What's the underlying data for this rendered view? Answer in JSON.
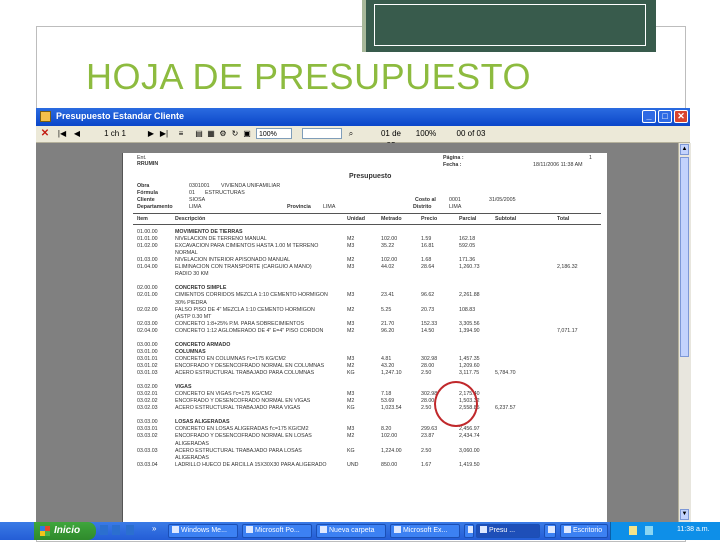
{
  "slide": {
    "title": "HOJA DE PRESUPUESTO"
  },
  "window": {
    "title": "Presupuesto Estandar Cliente",
    "toolbar": {
      "close_glyph": "✕",
      "first_glyph": "|◀",
      "prev_glyph": "◀",
      "page_indicator": "1 ch 1",
      "next_glyph": "▶",
      "last_glyph": "▶|",
      "zoom_value": "100%",
      "find_value": "",
      "status_a": "01 de 03",
      "status_b": "100%",
      "status_c": "00 of 03"
    }
  },
  "report": {
    "company_code": "Ent.",
    "company": "RRUMIN",
    "page_label": "Página :",
    "page_value": "1",
    "date_label": "Fecha :",
    "date_value": "18/11/2006  11:38  AM",
    "heading": "Presupuesto",
    "obra_label": "Obra",
    "obra_code": "0301001",
    "obra_value": "VIVIENDA UNIFAMILIAR",
    "formula_label": "Fórmula",
    "formula_code": "01",
    "formula_value": "ESTRUCTURAS",
    "cliente_label": "Cliente",
    "cliente_value": "SIOSA",
    "costo_label": "Costo al",
    "costo_code": "0001",
    "costo_value": "31/05/2005",
    "departamento_label": "Departamento",
    "departamento_value": "LIMA",
    "provincia_label": "Provincia",
    "provincia_value": "LIMA",
    "distrito_label": "Distrito",
    "distrito_value": "LIMA",
    "columns": [
      "Item",
      "Descripción",
      "Unidad",
      "Metrado",
      "Precio",
      "Parcial",
      "Subtotal",
      "Total"
    ],
    "rows": [
      {
        "item": "01.00.00",
        "desc": "MOVIMIENTO DE TIERRAS",
        "unit": "",
        "metrado": "",
        "precio": "",
        "parcial": "",
        "subtotal": "",
        "total": ""
      },
      {
        "item": "01.01.00",
        "desc": "NIVELACION DE TERRENO MANUAL",
        "unit": "M2",
        "metrado": "102.00",
        "precio": "1.59",
        "parcial": "162.18",
        "subtotal": "",
        "total": ""
      },
      {
        "item": "01.02.00",
        "desc": "EXCAVACION PARA CIMIENTOS HASTA 1.00 M TERRENO",
        "unit": "M3",
        "metrado": "35.22",
        "precio": "16.81",
        "parcial": "592.05",
        "subtotal": "",
        "total": ""
      },
      {
        "item": "",
        "desc": "NORMAL",
        "unit": "",
        "metrado": "",
        "precio": "",
        "parcial": "",
        "subtotal": "",
        "total": ""
      },
      {
        "item": "01.03.00",
        "desc": "NIVELACION INTERIOR APISONADO MANUAL",
        "unit": "M2",
        "metrado": "102.00",
        "precio": "1.68",
        "parcial": "171.36",
        "subtotal": "",
        "total": ""
      },
      {
        "item": "01.04.00",
        "desc": "ELIMINACION CON TRANSPORTE (CARGUIO A MANO)",
        "unit": "M3",
        "metrado": "44.02",
        "precio": "28.64",
        "parcial": "1,260.73",
        "subtotal": "",
        "total": "2,186.32"
      },
      {
        "item": "",
        "desc": "RADIO 30 KM",
        "unit": "",
        "metrado": "",
        "precio": "",
        "parcial": "",
        "subtotal": "",
        "total": ""
      },
      {
        "item": "",
        "desc": "",
        "unit": "",
        "metrado": "",
        "precio": "",
        "parcial": "",
        "subtotal": "",
        "total": ""
      },
      {
        "item": "02.00.00",
        "desc": "CONCRETO SIMPLE",
        "unit": "",
        "metrado": "",
        "precio": "",
        "parcial": "",
        "subtotal": "",
        "total": ""
      },
      {
        "item": "02.01.00",
        "desc": "CIMIENTOS CORRIDOS MEZCLA 1:10 CEMENTO HORMIGON",
        "unit": "M3",
        "metrado": "23.41",
        "precio": "96.62",
        "parcial": "2,261.88",
        "subtotal": "",
        "total": ""
      },
      {
        "item": "",
        "desc": "30% PIEDRA",
        "unit": "",
        "metrado": "",
        "precio": "",
        "parcial": "",
        "subtotal": "",
        "total": ""
      },
      {
        "item": "02.02.00",
        "desc": "FALSO PISO DE 4\" MEZCLA 1:10 CEMENTO HORMIGON",
        "unit": "M2",
        "metrado": "5.25",
        "precio": "20.73",
        "parcial": "108.83",
        "subtotal": "",
        "total": ""
      },
      {
        "item": "",
        "desc": "(ASTP 0.30 MT",
        "unit": "",
        "metrado": "",
        "precio": "",
        "parcial": "",
        "subtotal": "",
        "total": ""
      },
      {
        "item": "02.03.00",
        "desc": "CONCRETO 1:8+25% P.M. PARA SOBRECIMIENTOS",
        "unit": "M3",
        "metrado": "21.70",
        "precio": "152.33",
        "parcial": "3,305.56",
        "subtotal": "",
        "total": ""
      },
      {
        "item": "02.04.00",
        "desc": "CONCRETO 1:12 AGLOMERADO DE 4\" E=4\" PISO CORDON",
        "unit": "M2",
        "metrado": "96.20",
        "precio": "14.50",
        "parcial": "1,394.90",
        "subtotal": "",
        "total": "7,071.17"
      },
      {
        "item": "",
        "desc": "",
        "unit": "",
        "metrado": "",
        "precio": "",
        "parcial": "",
        "subtotal": "",
        "total": ""
      },
      {
        "item": "03.00.00",
        "desc": "CONCRETO ARMADO",
        "unit": "",
        "metrado": "",
        "precio": "",
        "parcial": "",
        "subtotal": "",
        "total": ""
      },
      {
        "item": "03.01.00",
        "desc": "COLUMNAS",
        "unit": "",
        "metrado": "",
        "precio": "",
        "parcial": "",
        "subtotal": "",
        "total": ""
      },
      {
        "item": "03.01.01",
        "desc": "CONCRETO EN COLUMNAS f'c=175 KG/CM2",
        "unit": "M3",
        "metrado": "4.81",
        "precio": "302.98",
        "parcial": "1,457.35",
        "subtotal": "",
        "total": ""
      },
      {
        "item": "03.01.02",
        "desc": "ENCOFRADO Y DESENCOFRADO NORMAL EN COLUMNAS",
        "unit": "M2",
        "metrado": "43.20",
        "precio": "28.00",
        "parcial": "1,209.60",
        "subtotal": "",
        "total": ""
      },
      {
        "item": "03.01.03",
        "desc": "ACERO ESTRUCTURAL TRABAJADO PARA COLUMNAS",
        "unit": "KG",
        "metrado": "1,247.10",
        "precio": "2.50",
        "parcial": "3,117.75",
        "subtotal": "5,784.70",
        "total": ""
      },
      {
        "item": "",
        "desc": "",
        "unit": "",
        "metrado": "",
        "precio": "",
        "parcial": "",
        "subtotal": "",
        "total": ""
      },
      {
        "item": "03.02.00",
        "desc": "VIGAS",
        "unit": "",
        "metrado": "",
        "precio": "",
        "parcial": "",
        "subtotal": "",
        "total": ""
      },
      {
        "item": "03.02.01",
        "desc": "CONCRETO EN VIGAS f'c=175 KG/CM2",
        "unit": "M3",
        "metrado": "7.18",
        "precio": "302.98",
        "parcial": "2,175.40",
        "subtotal": "",
        "total": ""
      },
      {
        "item": "03.02.02",
        "desc": "ENCOFRADO Y DESENCOFRADO NORMAL EN VIGAS",
        "unit": "M2",
        "metrado": "53.69",
        "precio": "28.00",
        "parcial": "1,503.32",
        "subtotal": "",
        "total": ""
      },
      {
        "item": "03.02.03",
        "desc": "ACERO ESTRUCTURAL TRABAJADO PARA VIGAS",
        "unit": "KG",
        "metrado": "1,023.54",
        "precio": "2.50",
        "parcial": "2,558.85",
        "subtotal": "6,237.57",
        "total": ""
      },
      {
        "item": "",
        "desc": "",
        "unit": "",
        "metrado": "",
        "precio": "",
        "parcial": "",
        "subtotal": "",
        "total": ""
      },
      {
        "item": "03.03.00",
        "desc": "LOSAS ALIGERADAS",
        "unit": "",
        "metrado": "",
        "precio": "",
        "parcial": "",
        "subtotal": "",
        "total": ""
      },
      {
        "item": "03.03.01",
        "desc": "CONCRETO EN LOSAS ALIGERADAS f'c=175 KG/CM2",
        "unit": "M3",
        "metrado": "8.20",
        "precio": "299.63",
        "parcial": "2,456.97",
        "subtotal": "",
        "total": ""
      },
      {
        "item": "03.03.02",
        "desc": "ENCOFRADO Y DESENCOFRADO NORMAL EN LOSAS",
        "unit": "M2",
        "metrado": "102.00",
        "precio": "23.87",
        "parcial": "2,434.74",
        "subtotal": "",
        "total": ""
      },
      {
        "item": "",
        "desc": "ALIGERADAS",
        "unit": "",
        "metrado": "",
        "precio": "",
        "parcial": "",
        "subtotal": "",
        "total": ""
      },
      {
        "item": "03.03.03",
        "desc": "ACERO ESTRUCTURAL TRABAJADO PARA LOSAS",
        "unit": "KG",
        "metrado": "1,224.00",
        "precio": "2.50",
        "parcial": "3,060.00",
        "subtotal": "",
        "total": ""
      },
      {
        "item": "",
        "desc": "ALIGERADAS",
        "unit": "",
        "metrado": "",
        "precio": "",
        "parcial": "",
        "subtotal": "",
        "total": ""
      },
      {
        "item": "03.03.04",
        "desc": "LADRILLO HUECO DE ARCILLA 15X30X30 PARA ALIGERADO",
        "unit": "UND",
        "metrado": "850.00",
        "precio": "1.67",
        "parcial": "1,419.50",
        "subtotal": "",
        "total": ""
      }
    ]
  },
  "taskbar": {
    "start_label": "Inicio",
    "quicklaunch": "»",
    "buttons": [
      "Windows Me...",
      "Microsoft Po...",
      "Nueva carpeta",
      "Microsoft Ex...",
      "",
      "Presu ...",
      "",
      "Escritorio"
    ],
    "clock": "11:38 a.m."
  }
}
